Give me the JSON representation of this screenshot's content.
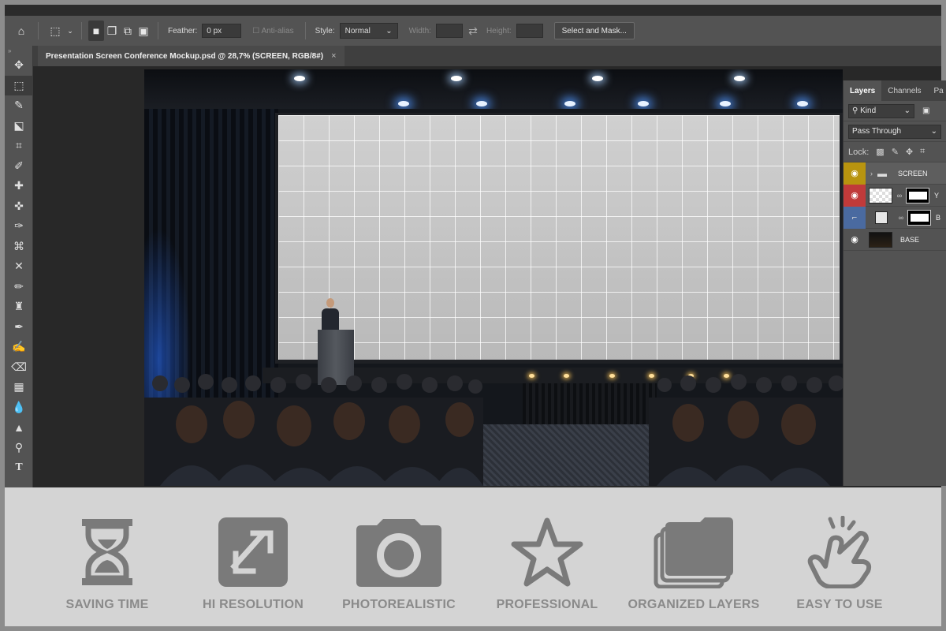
{
  "options_bar": {
    "feather_label": "Feather:",
    "feather_value": "0 px",
    "anti_alias_label": "Anti-alias",
    "style_label": "Style:",
    "style_value": "Normal",
    "width_label": "Width:",
    "height_label": "Height:",
    "select_mask_button": "Select and Mask..."
  },
  "document": {
    "tab_title": "Presentation Screen Conference Mockup.psd @ 28,7% (SCREEN, RGB/8#)",
    "close_glyph": "×"
  },
  "layers_panel": {
    "tabs": [
      "Layers",
      "Channels",
      "Pa"
    ],
    "kind_label": "Kind",
    "blend_mode": "Pass Through",
    "lock_label": "Lock:",
    "layers": [
      {
        "name": "SCREEN",
        "type": "group",
        "color": "#b8940f"
      },
      {
        "name": "Y",
        "type": "smart-object",
        "color": "#c03a3a"
      },
      {
        "name": "B",
        "type": "fill",
        "color": "#4a6aa0"
      },
      {
        "name": "BASE",
        "type": "image",
        "color": ""
      }
    ]
  },
  "features": [
    {
      "label": "SAVING TIME",
      "icon": "hourglass-icon"
    },
    {
      "label": "HI RESOLUTION",
      "icon": "expand-icon"
    },
    {
      "label": "PHOTOREALISTIC",
      "icon": "camera-icon"
    },
    {
      "label": "PROFESSIONAL",
      "icon": "star-icon"
    },
    {
      "label": "ORGANIZED LAYERS",
      "icon": "folders-icon"
    },
    {
      "label": "EASY TO USE",
      "icon": "pointing-hand-icon"
    }
  ],
  "colors": {
    "ui_panel": "#535353",
    "ui_dark": "#282828",
    "feature_bg": "#d4d4d4",
    "feature_icon": "#7a7a7a"
  }
}
